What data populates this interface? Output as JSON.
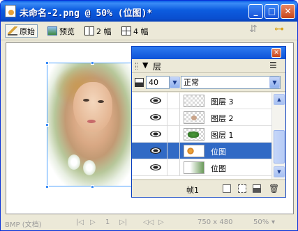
{
  "window": {
    "title": "未命名-2.png @  50% (位图)*",
    "buttons": {
      "minimize": "_",
      "maximize": "□",
      "close": "✕"
    }
  },
  "toolbar": {
    "original_label": "原始",
    "preview_label": "预览",
    "two_up_label": "2 幅",
    "four_up_label": "4 幅",
    "icons": [
      "pencil-icon",
      "preview-icon",
      "two-up-icon",
      "four-up-icon",
      "export-icon",
      "key-icon"
    ]
  },
  "status": {
    "file_type": "BMP (文档)",
    "frame": "1",
    "size": "750 x 480",
    "zoom": "50%"
  },
  "layers_panel": {
    "title": "层",
    "opacity": "40",
    "blend_mode": "正常",
    "layers": [
      {
        "name": "图层 3",
        "visible": true,
        "selected": false,
        "thumb": "empty"
      },
      {
        "name": "图层 2",
        "visible": true,
        "selected": false,
        "thumb": "small-object"
      },
      {
        "name": "图层 1",
        "visible": true,
        "selected": false,
        "thumb": "green-object"
      },
      {
        "name": "位图",
        "visible": true,
        "selected": true,
        "thumb": "flower"
      },
      {
        "name": "位图",
        "visible": true,
        "selected": false,
        "thumb": "gradient"
      }
    ],
    "frame_label": "帧1"
  },
  "colors": {
    "title_blue": "#0c5cdf",
    "selection_blue": "#316ac5",
    "window_face": "#ece9d8"
  }
}
